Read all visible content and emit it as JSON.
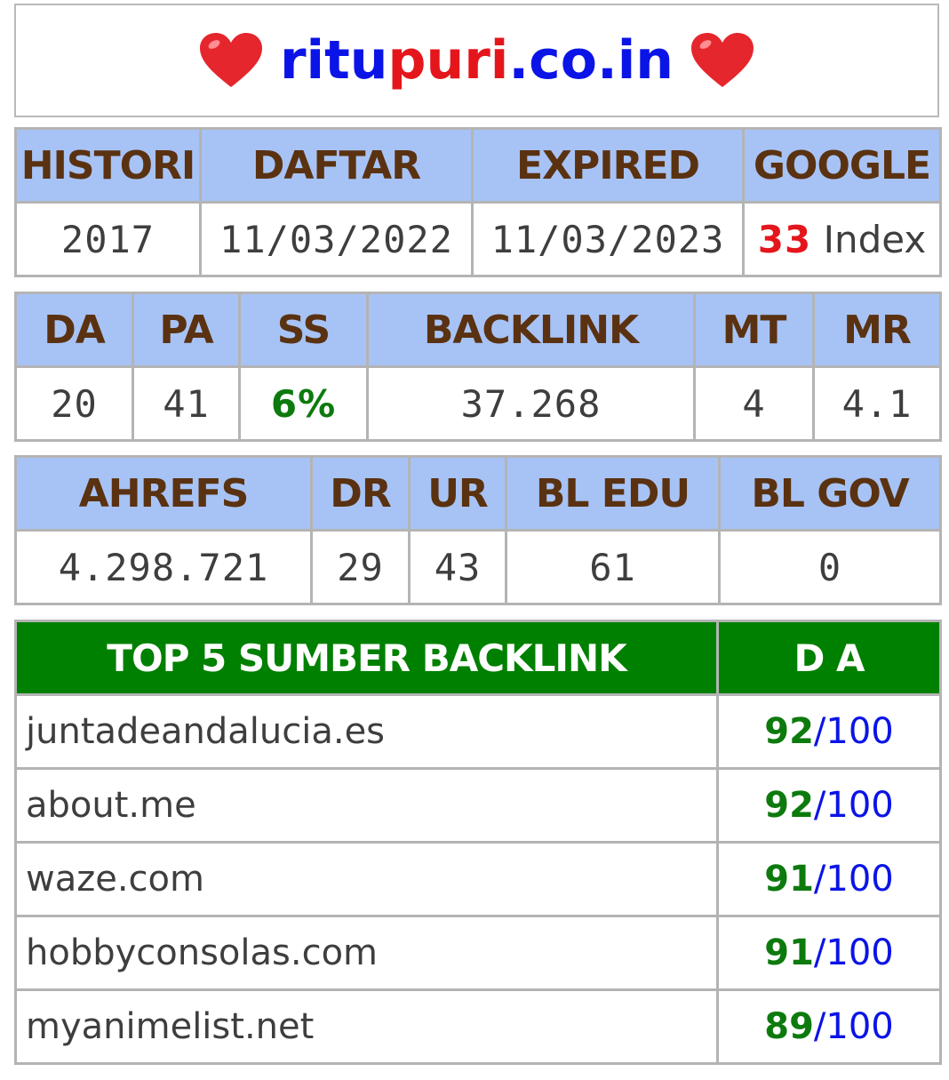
{
  "site": {
    "name_part1": "ritu",
    "name_part2": "puri",
    "name_part3": ".co.in"
  },
  "colors": {
    "header_bg": "#a7c3f6",
    "header_text": "#5a3211",
    "green_header": "#008000",
    "blue": "#0b14e6",
    "red": "#e4161c",
    "green": "#0d7a0d"
  },
  "table1": {
    "headers": [
      "HISTORI",
      "DAFTAR",
      "EXPIRED",
      "GOOGLE"
    ],
    "values": [
      "2017",
      "11/03/2022",
      "11/03/2023"
    ],
    "google_count": "33",
    "google_label": " Index"
  },
  "table2": {
    "headers": [
      "DA",
      "PA",
      "SS",
      "BACKLINK",
      "MT",
      "MR"
    ],
    "values": [
      "20",
      "41",
      "6%",
      "37.268",
      "4",
      "4.1"
    ]
  },
  "table3": {
    "headers": [
      "AHREFS",
      "DR",
      "UR",
      "BL EDU",
      "BL GOV"
    ],
    "values": [
      "4.298.721",
      "29",
      "43",
      "61",
      "0"
    ]
  },
  "table4": {
    "headers": [
      "TOP 5 SUMBER BACKLINK",
      "D A"
    ],
    "rows": [
      {
        "site": "juntadeandalucia.es",
        "da": "92",
        "max": "/100"
      },
      {
        "site": "about.me",
        "da": "92",
        "max": "/100"
      },
      {
        "site": "waze.com",
        "da": "91",
        "max": "/100"
      },
      {
        "site": "hobbyconsolas.com",
        "da": "91",
        "max": "/100"
      },
      {
        "site": "myanimelist.net",
        "da": "89",
        "max": "/100"
      }
    ]
  }
}
